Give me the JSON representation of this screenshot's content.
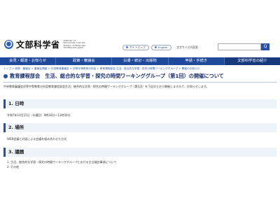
{
  "header": {
    "logo_title": "文部科学省",
    "logo_sub": "MINISTRY OF EDUCATION, CULTURE, SPORTS, SCIENCE AND TECHNOLOGY-JAPAN",
    "sitemap_label": "サイトマップ",
    "english_label": "English",
    "site_search_label": "文字サイズの変更",
    "search_button": "Q"
  },
  "nav": {
    "items": [
      "会見・報道・お知らせ",
      "政策・審議会",
      "白書・統計・出版物",
      "申請・手続き",
      "文部科学省の紹介"
    ]
  },
  "breadcrumb": "トップ > 政策・審議会 > 審議会情報 > 中央教育審議会 > 初等中等教育分科会 > 教育課程部会 生活、総合的な学習・探究の時間ワーキンググループ > 開催のお知らせ",
  "title": "教育課程部会　生活、総合的な学習・探究の時間ワーキンググループ（第1回）の開催について",
  "intro": "中央教育審議会初等中等教育分科会教育課程部会生活、総合的な学習・探究の時間ワーキンググループ（第1回）を下記のとおり開催しますので、お知らせします。",
  "sections": [
    {
      "head": "1. 日時",
      "body": [
        "令和7年10月15日（水曜日）9時30分～11時30分"
      ]
    },
    {
      "head": "2. 場所",
      "body": [
        "WEB会議と対面による会議を組み合わせた方式"
      ]
    },
    {
      "head": "3. 議題",
      "body": [
        "1. 生活、総合的な学習・探究の時間ワーキンググループにおける主な検討事項について",
        "2. その他"
      ]
    }
  ]
}
